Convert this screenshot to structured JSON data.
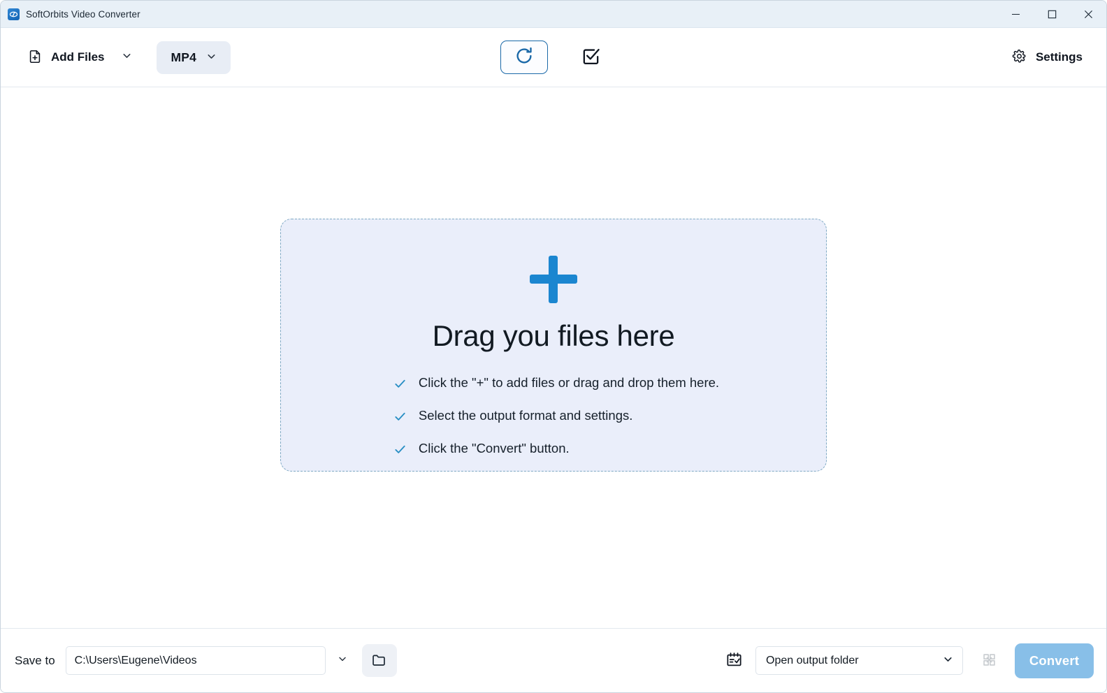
{
  "window": {
    "title": "SoftOrbits Video Converter",
    "app_icon": "softorbits-logo-icon",
    "controls": {
      "minimize": "minimize-icon",
      "maximize": "maximize-icon",
      "close": "close-icon"
    }
  },
  "toolbar": {
    "add_files_label": "Add Files",
    "add_files_icon": "file-plus-icon",
    "add_files_caret_icon": "chevron-down-icon",
    "format_label": "MP4",
    "format_caret_icon": "chevron-down-icon",
    "rotate_icon": "rotate-clockwise-icon",
    "select_all_icon": "checkbox-checked-icon",
    "settings_label": "Settings",
    "settings_icon": "gear-icon"
  },
  "dropzone": {
    "plus_icon": "plus-icon",
    "title": "Drag you files here",
    "hints": [
      "Click the \"+\" to add files or drag and drop them here.",
      "Select the output format and settings.",
      "Click the \"Convert\" button."
    ],
    "check_icon": "check-icon"
  },
  "bottombar": {
    "save_to_label": "Save to",
    "save_to_path": "C:\\Users\\Eugene\\Videos",
    "save_to_placeholder": "C:\\Users\\Eugene\\Videos",
    "path_caret_icon": "chevron-down-icon",
    "folder_icon": "folder-icon",
    "task_icon": "calendar-check-icon",
    "output_action_label": "Open output folder",
    "output_action_caret_icon": "chevron-down-icon",
    "merge_icon": "merge-grid-icon",
    "convert_label": "Convert"
  },
  "colors": {
    "titlebar_bg": "#e8f0f7",
    "accent_blue": "#1b86d0",
    "dropzone_bg": "#eaeefa",
    "dropzone_border": "#7fa9c4",
    "check_teal": "#2a8fc4",
    "convert_bg": "#88bfe8",
    "format_btn_bg": "#e8edf5",
    "main_bg": "#ffffff"
  }
}
